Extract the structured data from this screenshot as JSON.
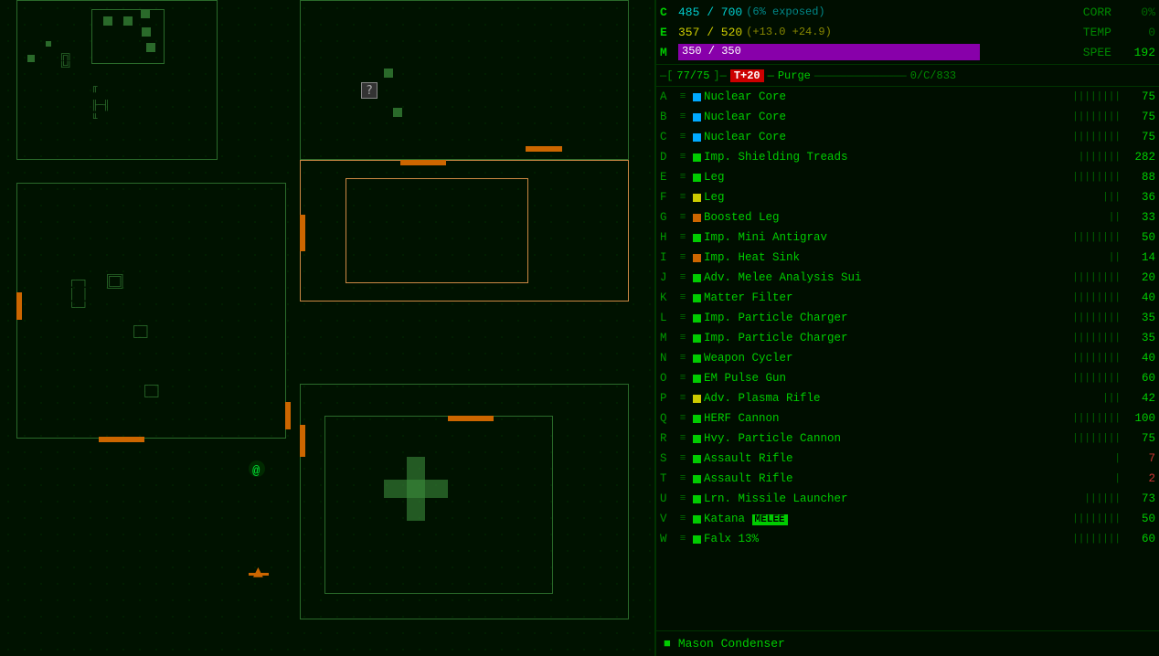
{
  "stats": {
    "c_label": "C",
    "c_value": "485 / 700",
    "c_note": "(6% exposed)",
    "corr_label": "CORR",
    "corr_value": "0%",
    "e_label": "E",
    "e_value": "357 / 520",
    "e_bonus": "(+13.0 +24.9)",
    "temp_label": "TEMP",
    "temp_value": "0",
    "m_label": "M",
    "m_value": "350 / 350",
    "spee_label": "SPEE",
    "spee_value": "192"
  },
  "action_bar": {
    "bracket_open": "[",
    "core_info": "77/75",
    "bracket_close": "]",
    "separator": "-",
    "heat_label": "T+20",
    "heat_separator": "—",
    "purge_label": "Purge",
    "purge_line": "——————",
    "slots": "0/C/833"
  },
  "inventory": [
    {
      "key": "A",
      "icon": "≡",
      "color": "#00aaff",
      "name": "Nuclear Core",
      "bars": "||||||||",
      "count": "75",
      "count_color": "normal"
    },
    {
      "key": "B",
      "icon": "≡",
      "color": "#00aaff",
      "name": "Nuclear Core",
      "bars": "||||||||",
      "count": "75",
      "count_color": "normal"
    },
    {
      "key": "C",
      "icon": "≡",
      "color": "#00aaff",
      "name": "Nuclear Core",
      "bars": "||||||||",
      "count": "75",
      "count_color": "normal"
    },
    {
      "key": "D",
      "icon": "⊙",
      "color": "#00cc00",
      "name": "Imp. Shielding Treads",
      "bars": "|||||||",
      "count": "282",
      "count_color": "normal"
    },
    {
      "key": "E",
      "icon": "↔",
      "color": "#00cc00",
      "name": "Leg",
      "bars": "||||||||",
      "count": "88",
      "count_color": "normal"
    },
    {
      "key": "F",
      "icon": "↔",
      "color": "#cccc00",
      "name": "Leg",
      "bars": "|||",
      "count": "36",
      "count_color": "normal"
    },
    {
      "key": "G",
      "icon": "↔",
      "color": "#cc6600",
      "name": "Boosted Leg",
      "bars": "||",
      "count": "33",
      "count_color": "normal"
    },
    {
      "key": "H",
      "icon": "✦",
      "color": "#00cc00",
      "name": "Imp. Mini Antigrav",
      "bars": "||||||||",
      "count": "50",
      "count_color": "normal"
    },
    {
      "key": "I",
      "icon": "✦",
      "color": "#cc6600",
      "name": "Imp. Heat Sink",
      "bars": "||",
      "count": "14",
      "count_color": "normal"
    },
    {
      "key": "J",
      "icon": "⁂",
      "color": "#00cc00",
      "name": "Adv. Melee Analysis Sui",
      "bars": "||||||||",
      "count": "20",
      "count_color": "normal"
    },
    {
      "key": "K",
      "icon": "⁂",
      "color": "#00cc00",
      "name": "Matter Filter",
      "bars": "||||||||",
      "count": "40",
      "count_color": "normal"
    },
    {
      "key": "L",
      "icon": "⁂",
      "color": "#00cc00",
      "name": "Imp. Particle Charger",
      "bars": "||||||||",
      "count": "35",
      "count_color": "normal"
    },
    {
      "key": "M",
      "icon": "⁂",
      "color": "#00cc00",
      "name": "Imp. Particle Charger",
      "bars": "||||||||",
      "count": "35",
      "count_color": "normal"
    },
    {
      "key": "N",
      "icon": "⁂",
      "color": "#00cc00",
      "name": "Weapon Cycler",
      "bars": "||||||||",
      "count": "40",
      "count_color": "normal"
    },
    {
      "key": "O",
      "icon": "⟐",
      "color": "#00cc00",
      "name": "EM Pulse Gun",
      "bars": "||||||||",
      "count": "60",
      "count_color": "normal"
    },
    {
      "key": "P",
      "icon": "⟐",
      "color": "#cccc00",
      "name": "Adv. Plasma Rifle",
      "bars": "|||",
      "count": "42",
      "count_color": "normal"
    },
    {
      "key": "Q",
      "icon": "⟐",
      "color": "#00cc00",
      "name": "HERF Cannon",
      "bars": "||||||||",
      "count": "100",
      "count_color": "normal"
    },
    {
      "key": "R",
      "icon": "⟐",
      "color": "#00cc00",
      "name": "Hvy. Particle Cannon",
      "bars": "||||||||",
      "count": "75",
      "count_color": "normal"
    },
    {
      "key": "S",
      "icon": "⟐",
      "color": "#00cc00",
      "name": "Assault Rifle",
      "bars": "|",
      "count": "7",
      "count_color": "red"
    },
    {
      "key": "T",
      "icon": "⟐",
      "color": "#00cc00",
      "name": "Assault Rifle",
      "bars": "|",
      "count": "2",
      "count_color": "red"
    },
    {
      "key": "U",
      "icon": "⟐",
      "color": "#00cc00",
      "name": "Lrn. Missile Launcher",
      "bars": "||||||",
      "count": "73",
      "count_color": "normal"
    },
    {
      "key": "V",
      "icon": "—",
      "color": "#00cc00",
      "name": "Katana",
      "melee": true,
      "bars": "||||||||",
      "count": "50",
      "count_color": "normal"
    },
    {
      "key": "W",
      "icon": "—",
      "color": "#00cc00",
      "name": "Falx 13%",
      "bars": "||||||||",
      "count": "60",
      "count_color": "normal"
    }
  ],
  "bottom_bar": {
    "dot": "■",
    "text": "Mason Condenser"
  }
}
